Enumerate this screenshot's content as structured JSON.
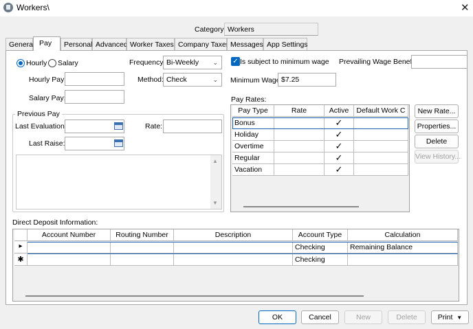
{
  "window": {
    "title": "Workers\\",
    "close": "✕"
  },
  "category": {
    "label": "Category:",
    "value": "Workers"
  },
  "tabs": [
    "General",
    "Pay",
    "Personal",
    "Advanced",
    "Worker Taxes",
    "Company Taxes",
    "Messages",
    "App Settings"
  ],
  "pay": {
    "hourly_label": "Hourly",
    "salary_label": "Salary",
    "frequency_label": "Frequency:",
    "frequency_value": "Bi-Weekly",
    "min_wage_check_label": "Is subject to minimum wage",
    "prevailing_label": "Prevailing Wage Benefit:",
    "prevailing_value": "",
    "hourly_pay_label": "Hourly Pay:",
    "hourly_pay_value": "",
    "method_label": "Method:",
    "method_value": "Check",
    "min_wage_label": "Minimum Wage:",
    "min_wage_value": "$7.25",
    "salary_pay_label": "Salary Pay:",
    "salary_pay_value": "",
    "previous_pay": {
      "title": "Previous Pay",
      "last_eval_label": "Last Evaluation:",
      "last_eval_value": "",
      "rate_label": "Rate:",
      "rate_value": "",
      "last_raise_label": "Last Raise:",
      "last_raise_value": ""
    }
  },
  "pay_rates": {
    "label": "Pay Rates:",
    "columns": [
      "Pay Type",
      "Rate",
      "Active",
      "Default Work C"
    ],
    "rows": [
      {
        "type": "Bonus",
        "rate": "",
        "active": "✓",
        "default": ""
      },
      {
        "type": "Holiday",
        "rate": "",
        "active": "✓",
        "default": ""
      },
      {
        "type": "Overtime",
        "rate": "",
        "active": "✓",
        "default": ""
      },
      {
        "type": "Regular",
        "rate": "",
        "active": "✓",
        "default": ""
      },
      {
        "type": "Vacation",
        "rate": "",
        "active": "✓",
        "default": ""
      }
    ],
    "buttons": {
      "new_rate": "New Rate...",
      "properties": "Properties...",
      "delete": "Delete",
      "view_history": "View History..."
    }
  },
  "direct_deposit": {
    "label": "Direct Deposit Information:",
    "columns": [
      "Account Number",
      "Routing Number",
      "Description",
      "Account Type",
      "Calculation"
    ],
    "rows": [
      {
        "indicator": "▸",
        "account": "",
        "routing": "",
        "description": "",
        "type": "Checking",
        "calc": "Remaining Balance"
      },
      {
        "indicator": "✱",
        "account": "",
        "routing": "",
        "description": "",
        "type": "Checking",
        "calc": ""
      }
    ]
  },
  "footer": {
    "ok": "OK",
    "cancel": "Cancel",
    "new": "New",
    "delete": "Delete",
    "print": "Print"
  }
}
